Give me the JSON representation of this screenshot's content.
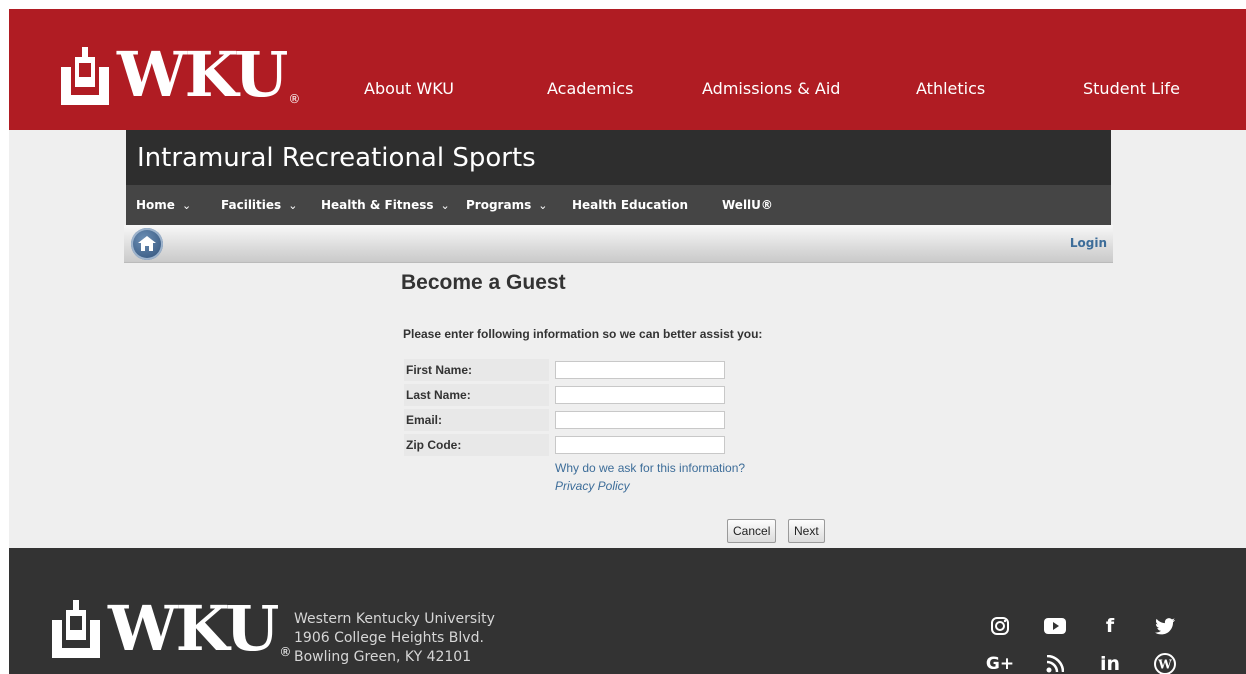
{
  "brand": {
    "logo_text": "WKU",
    "registered": "®"
  },
  "top_nav": [
    "About WKU",
    "Academics",
    "Admissions & Aid",
    "Athletics",
    "Student Life"
  ],
  "site": {
    "title": "Intramural Recreational Sports",
    "subnav": [
      "Home",
      "Facilities",
      "Health & Fitness",
      "Programs",
      "Health Education",
      "WellU®"
    ],
    "login": "Login"
  },
  "form": {
    "heading": "Become a Guest",
    "instructions": "Please enter following information so we can better assist you:",
    "fields": [
      {
        "label": "First Name:",
        "value": ""
      },
      {
        "label": "Last Name:",
        "value": ""
      },
      {
        "label": "Email:",
        "value": ""
      },
      {
        "label": "Zip Code:",
        "value": ""
      }
    ],
    "why_link": "Why do we ask for this information?",
    "privacy_link": "Privacy Policy",
    "cancel": "Cancel",
    "next": "Next"
  },
  "footer": {
    "address": [
      "Western Kentucky University",
      "1906 College Heights Blvd.",
      "Bowling Green, KY 42101"
    ],
    "social": [
      "instagram-icon",
      "youtube-icon",
      "facebook-icon",
      "twitter-icon",
      "google-plus-icon",
      "rss-icon",
      "linkedin-icon",
      "wordpress-icon"
    ]
  },
  "colors": {
    "brand_red": "#b01c23",
    "dark_header": "#2e2e2e",
    "subnav": "#454545",
    "link": "#3d6d99",
    "footer": "#333333"
  }
}
